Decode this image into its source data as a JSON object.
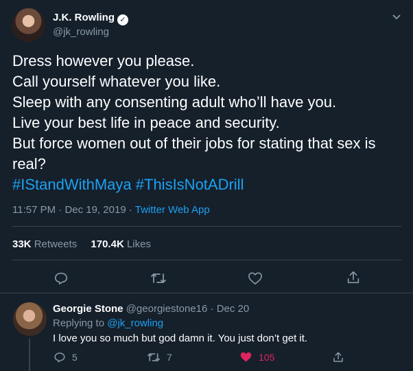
{
  "tweet": {
    "author_name": "J.K. Rowling",
    "author_handle": "@jk_rowling",
    "lines": [
      "Dress however you please.",
      "Call yourself whatever you like.",
      "Sleep with any consenting adult who’ll have you.",
      "Live your best life in peace and security.",
      "But force women out of their jobs for stating that sex is",
      "real?"
    ],
    "hashtags": [
      "#IStandWithMaya",
      "#ThisIsNotADrill"
    ],
    "time": "11:57 PM",
    "date": "Dec 19, 2019",
    "source": "Twitter Web App",
    "retweets_count": "33K",
    "retweets_label": "Retweets",
    "likes_count": "170.4K",
    "likes_label": "Likes"
  },
  "reply": {
    "author_name": "Georgie Stone",
    "author_handle": "@georgiestone16",
    "date": "Dec 20",
    "replying_to_label": "Replying to",
    "replying_to_handle": "@jk_rowling",
    "text": "I love you so much but god damn it. You just don’t get it.",
    "reply_count": "5",
    "retweet_count": "7",
    "like_count": "105"
  },
  "colors": {
    "background": "#15202b",
    "link": "#1da1f2",
    "muted": "#8899a6",
    "like_active": "#e0245e"
  },
  "icons": [
    "verified-badge-icon",
    "chevron-down-icon",
    "reply-icon",
    "retweet-icon",
    "like-icon",
    "share-icon"
  ]
}
